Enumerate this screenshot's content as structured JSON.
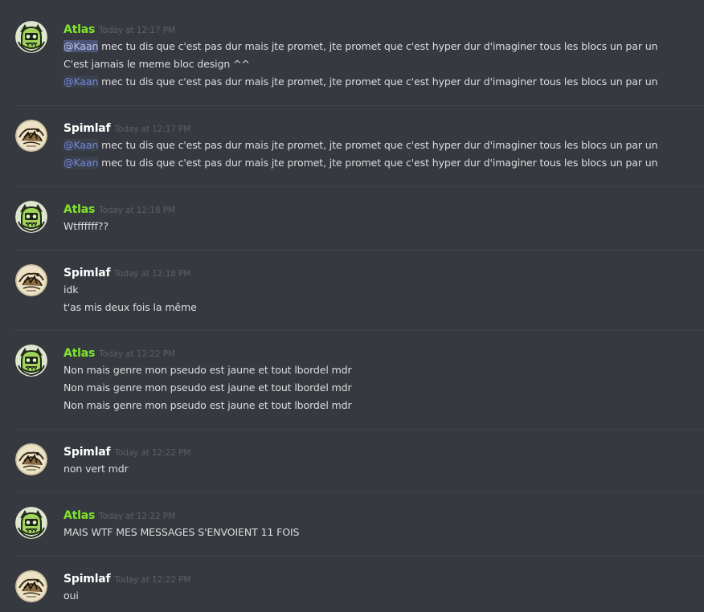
{
  "colors": {
    "background": "#36393f",
    "atlas_name": "#7fe52c",
    "spimlaf_name": "#ffffff",
    "text": "#dcddde",
    "mention": "#7289da",
    "timestamp": "#5d6066"
  },
  "users": {
    "atlas": {
      "name": "Atlas",
      "avatar_icon": "green-monster-avatar-icon"
    },
    "spimlaf": {
      "name": "Spimlaf",
      "avatar_icon": "sketch-avatar-icon"
    }
  },
  "messages": [
    {
      "author": "Atlas",
      "timestamp": "Today at 12:17 PM",
      "lines": [
        {
          "mention": "@Kaan",
          "text": " mec tu dis que c'est pas dur mais jte promet, jte promet que c'est hyper dur d'imaginer tous les blocs un par un"
        },
        {
          "mention": "",
          "text": "C'est jamais le meme bloc design ^^"
        },
        {
          "mention": "@Kaan",
          "text": " mec tu dis que c'est pas dur mais jte promet, jte promet que c'est hyper dur d'imaginer tous les blocs un par un"
        }
      ]
    },
    {
      "author": "Spimlaf",
      "timestamp": "Today at 12:17 PM",
      "lines": [
        {
          "mention": "@Kaan",
          "text": " mec tu dis que c'est pas dur mais jte promet, jte promet que c'est hyper dur d'imaginer tous les blocs un par un"
        },
        {
          "mention": "@Kaan",
          "text": " mec tu dis que c'est pas dur mais jte promet, jte promet que c'est hyper dur d'imaginer tous les blocs un par un"
        }
      ]
    },
    {
      "author": "Atlas",
      "timestamp": "Today at 12:18 PM",
      "lines": [
        {
          "mention": "",
          "text": "Wtffffff??"
        }
      ]
    },
    {
      "author": "Spimlaf",
      "timestamp": "Today at 12:18 PM",
      "lines": [
        {
          "mention": "",
          "text": "idk"
        },
        {
          "mention": "",
          "text": "t'as mis deux fois la même"
        }
      ]
    },
    {
      "author": "Atlas",
      "timestamp": "Today at 12:22 PM",
      "lines": [
        {
          "mention": "",
          "text": "Non mais genre mon pseudo est jaune et tout lbordel mdr"
        },
        {
          "mention": "",
          "text": "Non mais genre mon pseudo est jaune et tout lbordel mdr"
        },
        {
          "mention": "",
          "text": "Non mais genre mon pseudo est jaune et tout lbordel mdr"
        }
      ]
    },
    {
      "author": "Spimlaf",
      "timestamp": "Today at 12:22 PM",
      "lines": [
        {
          "mention": "",
          "text": "non vert mdr"
        }
      ]
    },
    {
      "author": "Atlas",
      "timestamp": "Today at 12:22 PM",
      "lines": [
        {
          "mention": "",
          "text": "MAIS WTF MES MESSAGES S'ENVOIENT 11 FOIS"
        }
      ]
    },
    {
      "author": "Spimlaf",
      "timestamp": "Today at 12:22 PM",
      "lines": [
        {
          "mention": "",
          "text": "oui"
        }
      ]
    }
  ]
}
